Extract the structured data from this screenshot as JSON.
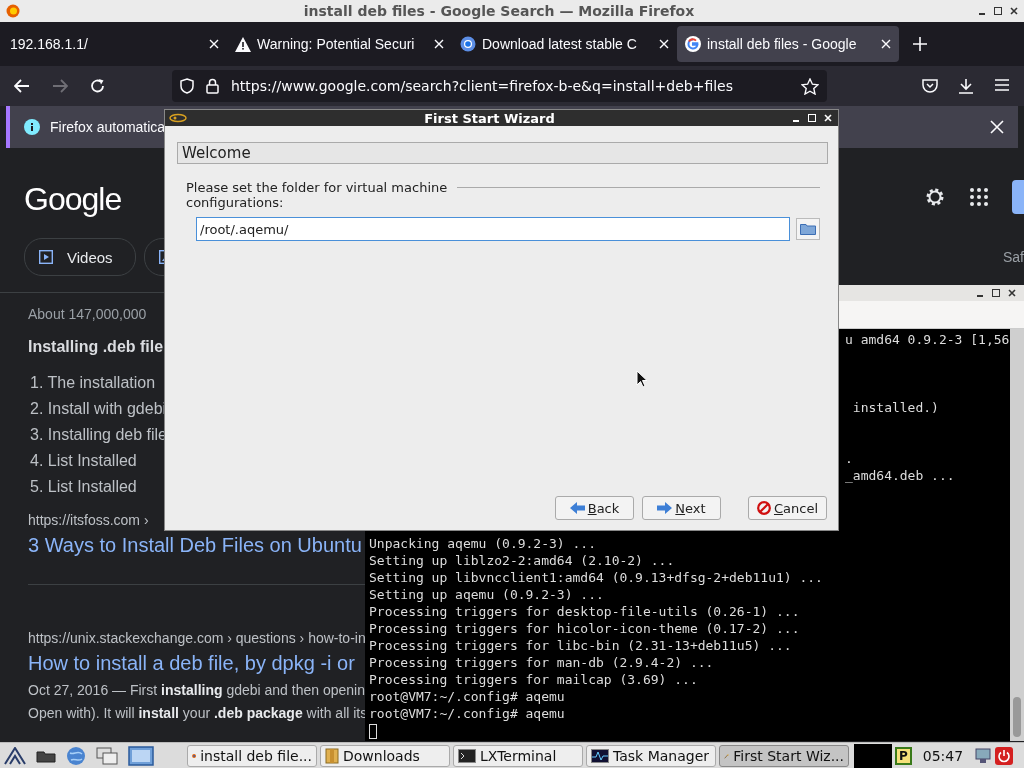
{
  "browser": {
    "title": "install deb files - Google Search — Mozilla Firefox",
    "tabs": [
      {
        "label": "192.168.1.1/",
        "selected": false
      },
      {
        "label": "Warning: Potential Securi",
        "selected": false
      },
      {
        "label": "Download latest stable C",
        "selected": false
      },
      {
        "label": "install deb files - Google",
        "selected": true
      }
    ],
    "url": "https://www.google.com/search?client=firefox-b-e&q=install+deb+files",
    "notification": "Firefox automatica"
  },
  "google": {
    "logo": "Google",
    "filters": [
      "Videos"
    ],
    "side_text": "Saf",
    "results_count": "About 147,000,000",
    "snippet_heading": "Installing .deb file",
    "snippet_list": [
      "1. The installation",
      "2. Install with gdebi",
      "3. Installing deb file",
      "4. List Installed",
      "5. List Installed"
    ],
    "results": [
      {
        "url": "https://itsfoss.com ›",
        "title": "3 Ways to Install Deb Files on Ubuntu"
      },
      {
        "url": "https://unix.stackexchange.com › questions › how-to-in",
        "title": "How to install a deb file, by dpkg -i or",
        "snippet_lines": [
          "Oct 27, 2016 — First **installing** gdebi and then openin",
          "Open with). It will **install** your **.deb package** with all its"
        ]
      }
    ]
  },
  "terminal": {
    "rows": [
      {
        "kind": "tail",
        "text": "u amd64 0.9.2-3 [1,56"
      },
      {
        "kind": "gap"
      },
      {
        "kind": "gap"
      },
      {
        "kind": "gap"
      },
      {
        "kind": "tail",
        "text": " installed.)"
      },
      {
        "kind": "gap"
      },
      {
        "kind": "gap"
      },
      {
        "kind": "tail",
        "text": "."
      },
      {
        "kind": "tail",
        "text": "_amd64.deb ..."
      },
      {
        "kind": "gap"
      },
      {
        "kind": "gap"
      },
      {
        "kind": "gap"
      },
      {
        "kind": "full",
        "text": "Unpacking aqemu (0.9.2-3) ..."
      },
      {
        "kind": "full",
        "text": "Setting up liblzo2-2:amd64 (2.10-2) ..."
      },
      {
        "kind": "full",
        "text": "Setting up libvncclient1:amd64 (0.9.13+dfsg-2+deb11u1) ..."
      },
      {
        "kind": "full",
        "text": "Setting up aqemu (0.9.2-3) ..."
      },
      {
        "kind": "full",
        "text": "Processing triggers for desktop-file-utils (0.26-1) ..."
      },
      {
        "kind": "full",
        "text": "Processing triggers for hicolor-icon-theme (0.17-2) ..."
      },
      {
        "kind": "full",
        "text": "Processing triggers for libc-bin (2.31-13+deb11u5) ..."
      },
      {
        "kind": "full",
        "text": "Processing triggers for man-db (2.9.4-2) ..."
      },
      {
        "kind": "full",
        "text": "Processing triggers for mailcap (3.69) ..."
      },
      {
        "kind": "full",
        "text": "root@VM7:~/.config# aqemu"
      },
      {
        "kind": "full",
        "text": "root@VM7:~/.config# aqemu"
      },
      {
        "kind": "cursor"
      }
    ]
  },
  "wizard": {
    "title": "First Start Wizard",
    "heading": "Welcome",
    "label": "Please set the folder for virtual machine configurations:",
    "folder": "/root/.aqemu/",
    "buttons": [
      {
        "label": "Back",
        "kind": "back"
      },
      {
        "label": "Next",
        "kind": "next"
      },
      {
        "label": "Cancel",
        "kind": "cancel"
      }
    ]
  },
  "taskbar": {
    "tasks": [
      {
        "label": "install deb file...",
        "selected": false
      },
      {
        "label": "Downloads",
        "selected": false
      },
      {
        "label": "LXTerminal",
        "selected": false
      },
      {
        "label": "Task Manager",
        "selected": false
      },
      {
        "label": "First Start Wiz...",
        "selected": true
      }
    ],
    "tray_letter": "P",
    "clock": "05:47"
  }
}
